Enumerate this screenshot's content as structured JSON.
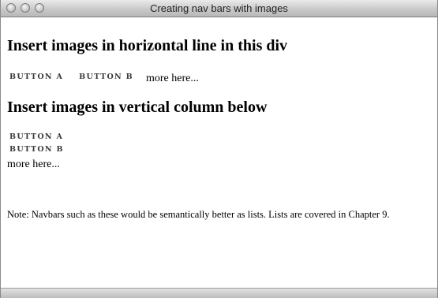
{
  "window": {
    "title": "Creating nav bars with images"
  },
  "content": {
    "heading_horizontal": "Insert images in horizontal line in this div",
    "horizontal_nav": {
      "button_a": "BUTTON A",
      "button_b": "BUTTON B",
      "more": "more here..."
    },
    "heading_vertical": "Insert images in vertical column below",
    "vertical_nav": {
      "button_a": "BUTTON A",
      "button_b": "BUTTON B",
      "more": "more here..."
    },
    "note": "Note: Navbars such as these would be semantically better as lists. Lists are covered in Chapter 9."
  }
}
